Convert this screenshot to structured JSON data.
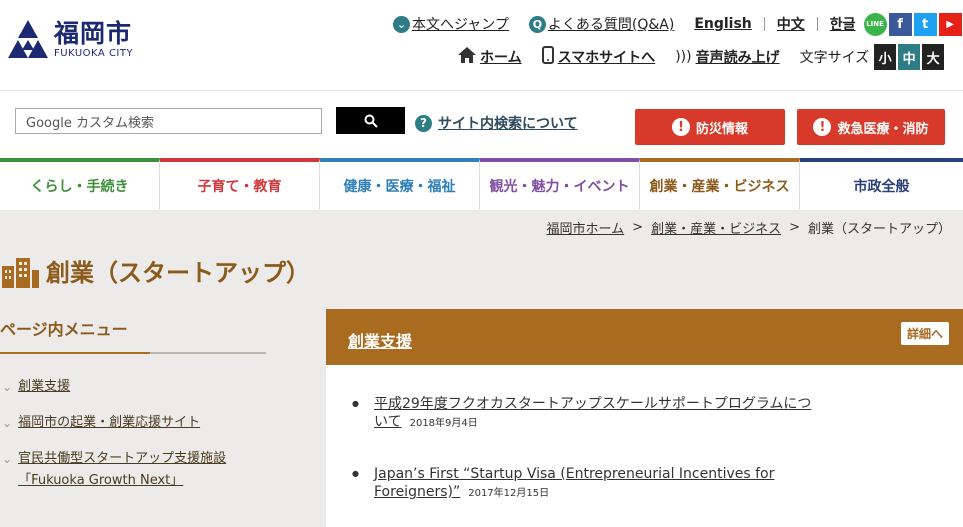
{
  "header": {
    "logo_ja": "福岡市",
    "logo_en": "FUKUOKA CITY",
    "links_row1": {
      "jump": "本文へジャンプ",
      "faq": "よくある質問(Q&A)",
      "english": "English",
      "chinese": "中文",
      "korean": "한글"
    },
    "links_row2": {
      "home": "ホーム",
      "smartphone": "スマホサイトへ",
      "voice": "音声読み上げ",
      "font_size_label": "文字サイズ",
      "font_small": "小",
      "font_medium": "中",
      "font_large": "大"
    },
    "sns": {
      "line": "LINE",
      "facebook": "f",
      "twitter": "t",
      "youtube": "▶"
    }
  },
  "search": {
    "placeholder": "Google カスタム検索",
    "help_link": "サイト内検索について",
    "disaster": "防災情報",
    "emergency": "救急医療・消防"
  },
  "nav": [
    {
      "label": "くらし・手続き",
      "color": "#3f8f3a"
    },
    {
      "label": "子育て・教育",
      "color": "#d0383c"
    },
    {
      "label": "健康・医療・福祉",
      "color": "#2f7fb8"
    },
    {
      "label": "観光・魅力・イベント",
      "color": "#7f4fa0"
    },
    {
      "label": "創業・産業・ビジネス",
      "color": "#a86b1f"
    },
    {
      "label": "市政全般",
      "color": "#2a3f7a"
    }
  ],
  "breadcrumb": {
    "home": "福岡市ホーム",
    "parent": "創業・産業・ビジネス",
    "current": "創業（スタートアップ）"
  },
  "page_title": "創業（スタートアップ）",
  "sidebar": {
    "heading": "ページ内メニュー",
    "items": [
      {
        "label": "創業支援"
      },
      {
        "label": "福岡市の起業・創業応援サイト"
      },
      {
        "label": "官民共働型スタートアップ支援施設「Fukuoka Growth Next」"
      }
    ]
  },
  "panel": {
    "title": "創業支援",
    "detail": "詳細へ",
    "items": [
      {
        "title": "平成29年度フクオカスタートアップスケールサポートプログラムについて",
        "date": "2018年9月4日"
      },
      {
        "title": "Japan’s First “Startup Visa (Entrepreneurial Incentives for Foreigners)”",
        "date": "2017年12月15日"
      }
    ]
  },
  "colors": {
    "brand_navy": "#1b2a73",
    "accent_brown": "#a86b1f",
    "alert_red": "#d73a2a",
    "teal": "#2e7d86"
  }
}
